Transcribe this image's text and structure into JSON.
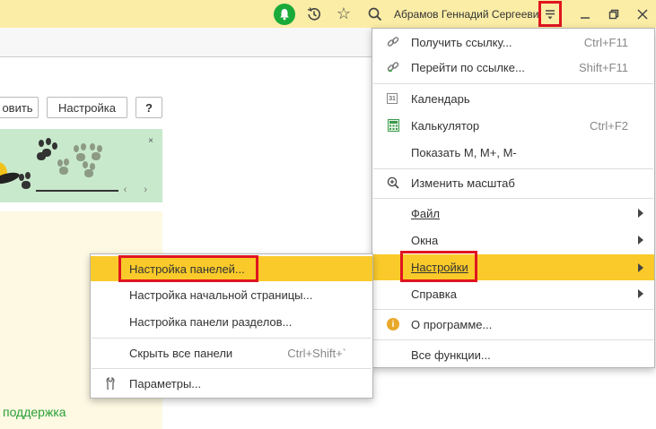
{
  "titlebar": {
    "username": "Абрамов Геннадий Сергеевич",
    "icons": [
      "bell-icon",
      "history-icon",
      "star-icon",
      "search-icon",
      "menu-icon",
      "minimize-icon",
      "restore-icon",
      "close-icon"
    ],
    "bell_color": "#1aaa3a",
    "bg_color": "#fbeda6"
  },
  "background": {
    "buttons": {
      "update_partial": "овить",
      "settings": "Настройка",
      "help": "?"
    },
    "banner_close": "×",
    "banner_nav": "‹ ›",
    "support_text": "поддержка"
  },
  "main_menu": {
    "items": [
      {
        "label": "Получить ссылку...",
        "shortcut": "Ctrl+F11",
        "icon": "link-icon"
      },
      {
        "label": "Перейти по ссылке...",
        "shortcut": "Shift+F11",
        "icon": "goto-link-icon"
      },
      {
        "label": "Календарь",
        "shortcut": "",
        "icon": "calendar-icon",
        "icon_text": "31"
      },
      {
        "label": "Калькулятор",
        "shortcut": "Ctrl+F2",
        "icon": "calculator-icon"
      },
      {
        "label": "Показать M, M+, M-",
        "shortcut": "",
        "icon": ""
      },
      {
        "label": "Изменить масштаб",
        "shortcut": "",
        "icon": "zoom-icon"
      },
      {
        "label": "Файл",
        "shortcut": "",
        "icon": "",
        "submenu": true
      },
      {
        "label": "Окна",
        "shortcut": "",
        "icon": "",
        "submenu": true
      },
      {
        "label": "Настройки",
        "shortcut": "",
        "icon": "",
        "submenu": true,
        "highlighted": true
      },
      {
        "label": "Справка",
        "shortcut": "",
        "icon": "",
        "submenu": true
      },
      {
        "label": "О программе...",
        "shortcut": "",
        "icon": "info-icon",
        "icon_text": "i"
      },
      {
        "label": "Все функции...",
        "shortcut": "",
        "icon": ""
      }
    ],
    "highlight_color": "#f9ca2a",
    "callout_color": "#e0151f"
  },
  "submenu": {
    "items": [
      {
        "label": "Настройка панелей...",
        "shortcut": "",
        "highlighted": true
      },
      {
        "label": "Настройка начальной страницы...",
        "shortcut": ""
      },
      {
        "label": "Настройка панели разделов...",
        "shortcut": ""
      },
      {
        "label": "Скрыть все панели",
        "shortcut": "Ctrl+Shift+`"
      },
      {
        "label": "Параметры...",
        "shortcut": "",
        "icon": "wrench-icon"
      }
    ]
  }
}
